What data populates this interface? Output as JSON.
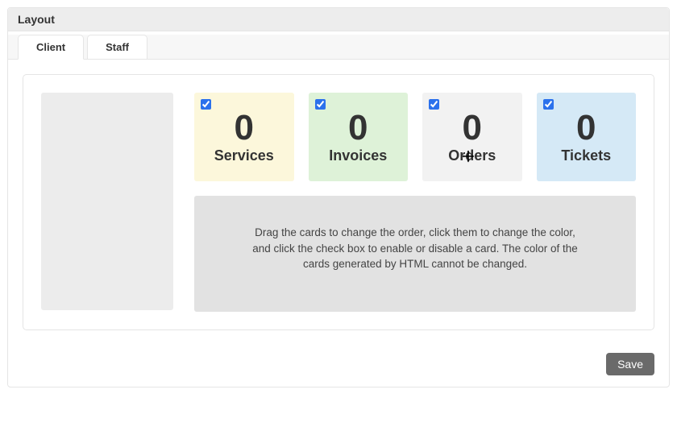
{
  "panel": {
    "title": "Layout"
  },
  "tabs": {
    "client": "Client",
    "staff": "Staff"
  },
  "cards": {
    "services": {
      "value": "0",
      "label": "Services",
      "checked": true
    },
    "invoices": {
      "value": "0",
      "label": "Invoices",
      "checked": true
    },
    "orders": {
      "value": "0",
      "label": "Orders",
      "checked": true
    },
    "tickets": {
      "value": "0",
      "label": "Tickets",
      "checked": true
    }
  },
  "instructions": "Drag the cards to change the order, click them to change the color, and click the check box to enable or disable a card. The color of the cards generated by HTML cannot be changed.",
  "actions": {
    "save": "Save"
  }
}
